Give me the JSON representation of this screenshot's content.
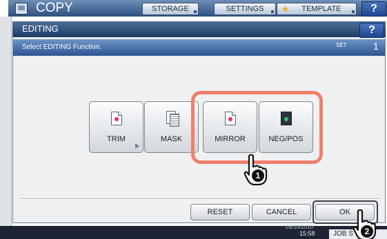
{
  "background_screen": {
    "title": "COPY",
    "tabs": [
      {
        "label": "STORAGE"
      },
      {
        "label": "SETTINGS"
      },
      {
        "label": "TEMPLATE"
      }
    ],
    "help_label": "?",
    "clock_top": "09/10/2010",
    "clock": "15:58",
    "jobs_label": "JOB S"
  },
  "dialog": {
    "title": "EDITING",
    "help_label": "?",
    "message": "Select EDITING Function.",
    "set_label": "SET",
    "set_count": "1"
  },
  "functions": [
    {
      "label": "TRIM"
    },
    {
      "label": "MASK"
    },
    {
      "label": "MIRROR"
    },
    {
      "label": "NEG/POS"
    }
  ],
  "footer": {
    "reset_label": "RESET",
    "cancel_label": "CANCEL",
    "ok_label": "OK"
  },
  "callouts": {
    "step1": "1",
    "step2": "2"
  },
  "colors": {
    "highlight": "#f08069",
    "title_bar": "#1d3c64",
    "message_bar": "#2d5592"
  }
}
